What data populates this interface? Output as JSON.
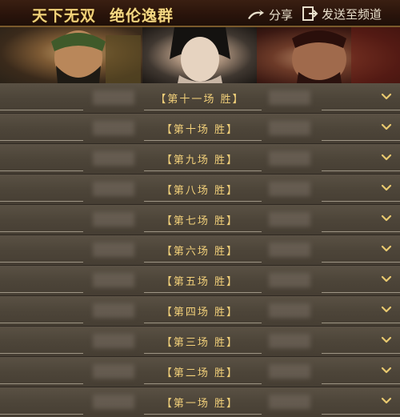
{
  "header": {
    "title_main": "天下无双",
    "title_sub": "绝伦逸群",
    "share_label": "分享",
    "send_label": "发送至频道"
  },
  "portraits": [
    {
      "icon": "warrior-portrait-green-icon"
    },
    {
      "icon": "woman-portrait-icon"
    },
    {
      "icon": "warrior-portrait-red-icon"
    }
  ],
  "matches": [
    {
      "label": "【第十一场 胜】"
    },
    {
      "label": "【第十场 胜】"
    },
    {
      "label": "【第九场 胜】"
    },
    {
      "label": "【第八场 胜】"
    },
    {
      "label": "【第七场 胜】"
    },
    {
      "label": "【第六场 胜】"
    },
    {
      "label": "【第五场 胜】"
    },
    {
      "label": "【第四场 胜】"
    },
    {
      "label": "【第三场 胜】"
    },
    {
      "label": "【第二场 胜】"
    },
    {
      "label": "【第一场 胜】"
    }
  ],
  "colors": {
    "accent_gold": "#f2d07a",
    "row_bg": "#4d4539",
    "header_bg": "#2a140b"
  }
}
